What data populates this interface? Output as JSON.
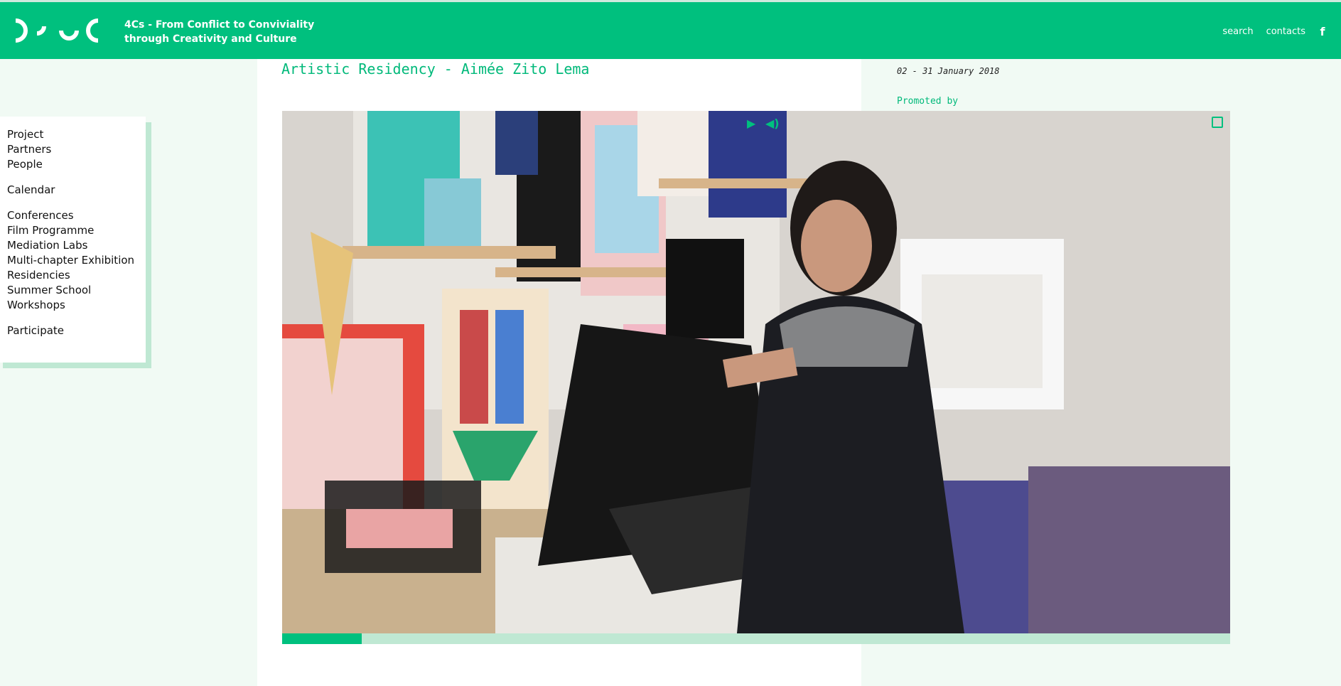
{
  "header": {
    "title_line1": "4Cs - From Conflict to Conviviality",
    "title_line2": "through Creativity and Culture",
    "nav": {
      "search": "search",
      "contacts": "contacts",
      "facebook_icon": "f"
    },
    "brand_color": "#00c07e"
  },
  "menu": {
    "group1": [
      "Project",
      "Partners",
      "People"
    ],
    "group2": [
      "Calendar"
    ],
    "group3": [
      "Conferences",
      "Film Programme",
      "Mediation Labs",
      "Multi-chapter Exhibition",
      "Residencies",
      "Summer School",
      "Workshops"
    ],
    "group4": [
      "Participate"
    ]
  },
  "article": {
    "title": "Artistic Residency - Aimée Zito Lema"
  },
  "sidebar": {
    "dates": "02 - 31 January 2018",
    "promoted_label": "Promoted by"
  },
  "video": {
    "progress_fraction": 0.084,
    "controls": {
      "play_icon": "play-icon",
      "volume_icon": "volume-icon",
      "fullscreen_icon": "fullscreen-icon"
    }
  }
}
